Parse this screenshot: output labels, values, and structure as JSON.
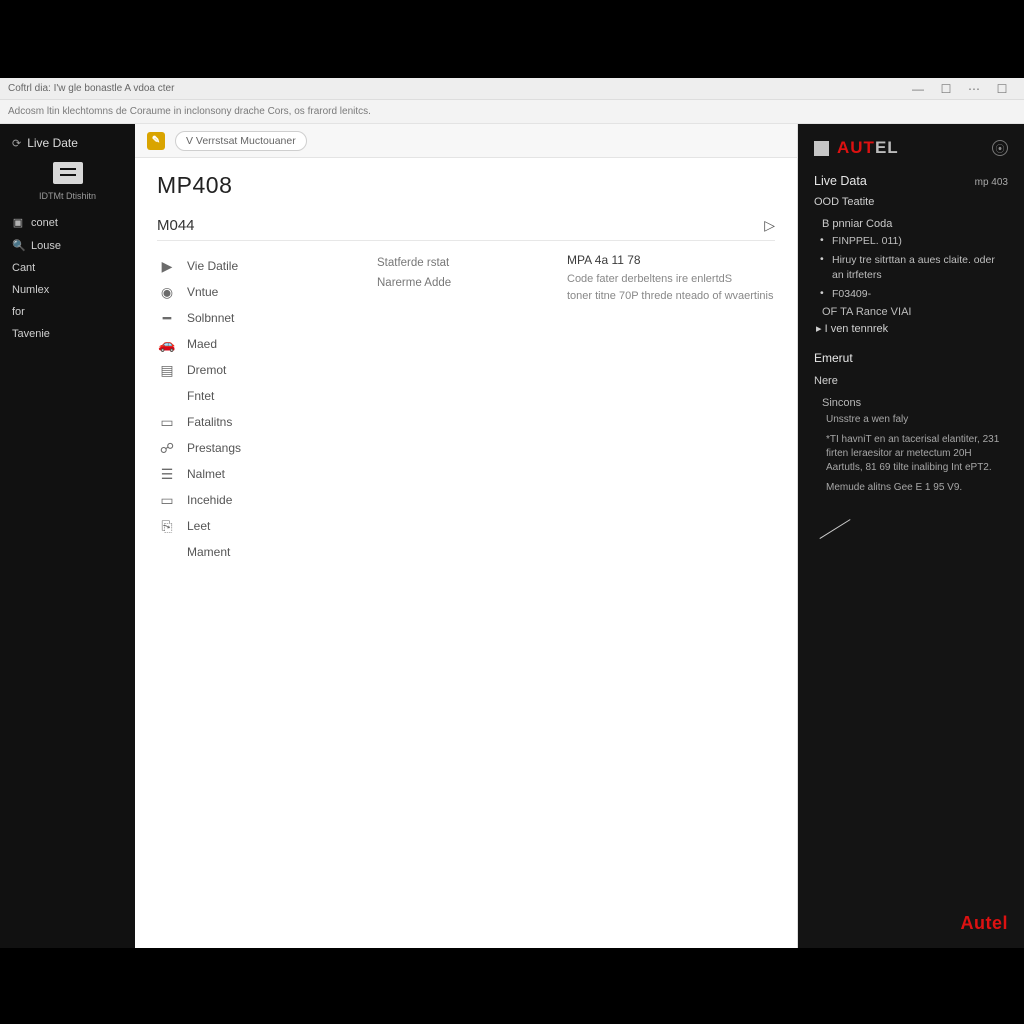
{
  "window": {
    "title": "Coftrl dia: I'w gle bonastle A vdoa cter",
    "address": "Adcosm ltin klechtomns de Coraume in inclonsony drache Cors, os frarord lenitcs."
  },
  "sidebar": {
    "header": "Live Date",
    "device_caption": "IDTMt Dtishitn",
    "items": [
      "conet",
      "Louse",
      "Cant",
      "Numlex",
      "for",
      "Tavenie"
    ]
  },
  "toolbar": {
    "chip": "V Verrstsat Muctouaner"
  },
  "page": {
    "title": "MP408",
    "subtitle": "M044",
    "list": [
      "Vie Datile",
      "Vntue",
      "Solbnnet",
      "Maed",
      "Dremot",
      "Fntet",
      "Fatalitns",
      "Prestangs",
      "Nalmet",
      "Incehide",
      "Leet",
      "Mament"
    ],
    "info": [
      "Statferde rstat",
      "Narerme Adde"
    ],
    "detail": {
      "heading": "MPA 4a 11 78",
      "lines": [
        "Code fater derbeltens ire enlertdS",
        "toner titne 70P threde nteado of wvaertinis"
      ]
    }
  },
  "right": {
    "brand_a": "AUT",
    "brand_b": "EL",
    "title": "Live Data",
    "model": "mp 403",
    "subtitle": "OOD Teatite",
    "section1": {
      "key": "B pnniar Coda",
      "bullets": [
        "FINPPEL.  011)",
        "Hiruy tre sitrttan a aues claite. oder an itrfeters",
        "F03409-"
      ],
      "foot": "OF TA Rance VIAI",
      "link": "I ven tennrek"
    },
    "section2": {
      "title": "Emerut",
      "sub": "Nere",
      "k1": "Sincons",
      "p1": "Unsstre a wen faly",
      "p2": "*TI havniT en an tacerisal elantiter, 231 firten leraesitor ar metectum 20H Aartutls, 81 69 tilte inalibing Int ePT2.",
      "p3": "Memude alitns Gee E 1 95 V9."
    },
    "brand_footer": "Autel"
  }
}
